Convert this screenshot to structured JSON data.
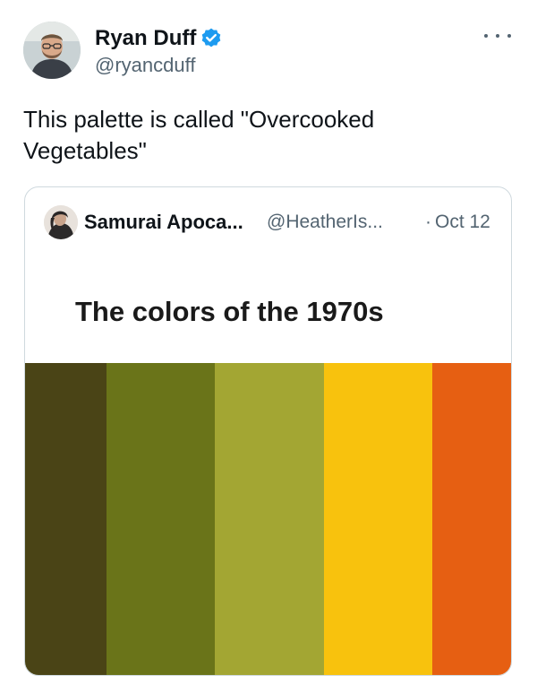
{
  "tweet": {
    "author_name": "Ryan Duff",
    "author_handle": "@ryancduff",
    "verified_color": "#1d9bf0",
    "text": "This palette is called \"Overcooked\nVegetables\""
  },
  "quote": {
    "author_name": "Samurai Apoca...",
    "author_handle": "@HeatherIs...",
    "separator": "·",
    "date": "Oct 12",
    "image": {
      "title": "The colors of the 1970s",
      "swatches": [
        {
          "name": "dark-olive-swatch",
          "color": "#4a4416"
        },
        {
          "name": "olive-green-swatch",
          "color": "#6a7419"
        },
        {
          "name": "avocado-swatch",
          "color": "#a3a633"
        },
        {
          "name": "harvest-gold-swatch",
          "color": "#f8c20d"
        },
        {
          "name": "burnt-orange-swatch",
          "color": "#e65f12"
        }
      ]
    }
  },
  "icons": {
    "verified": "verified-badge-icon",
    "more": "more-options-icon"
  }
}
